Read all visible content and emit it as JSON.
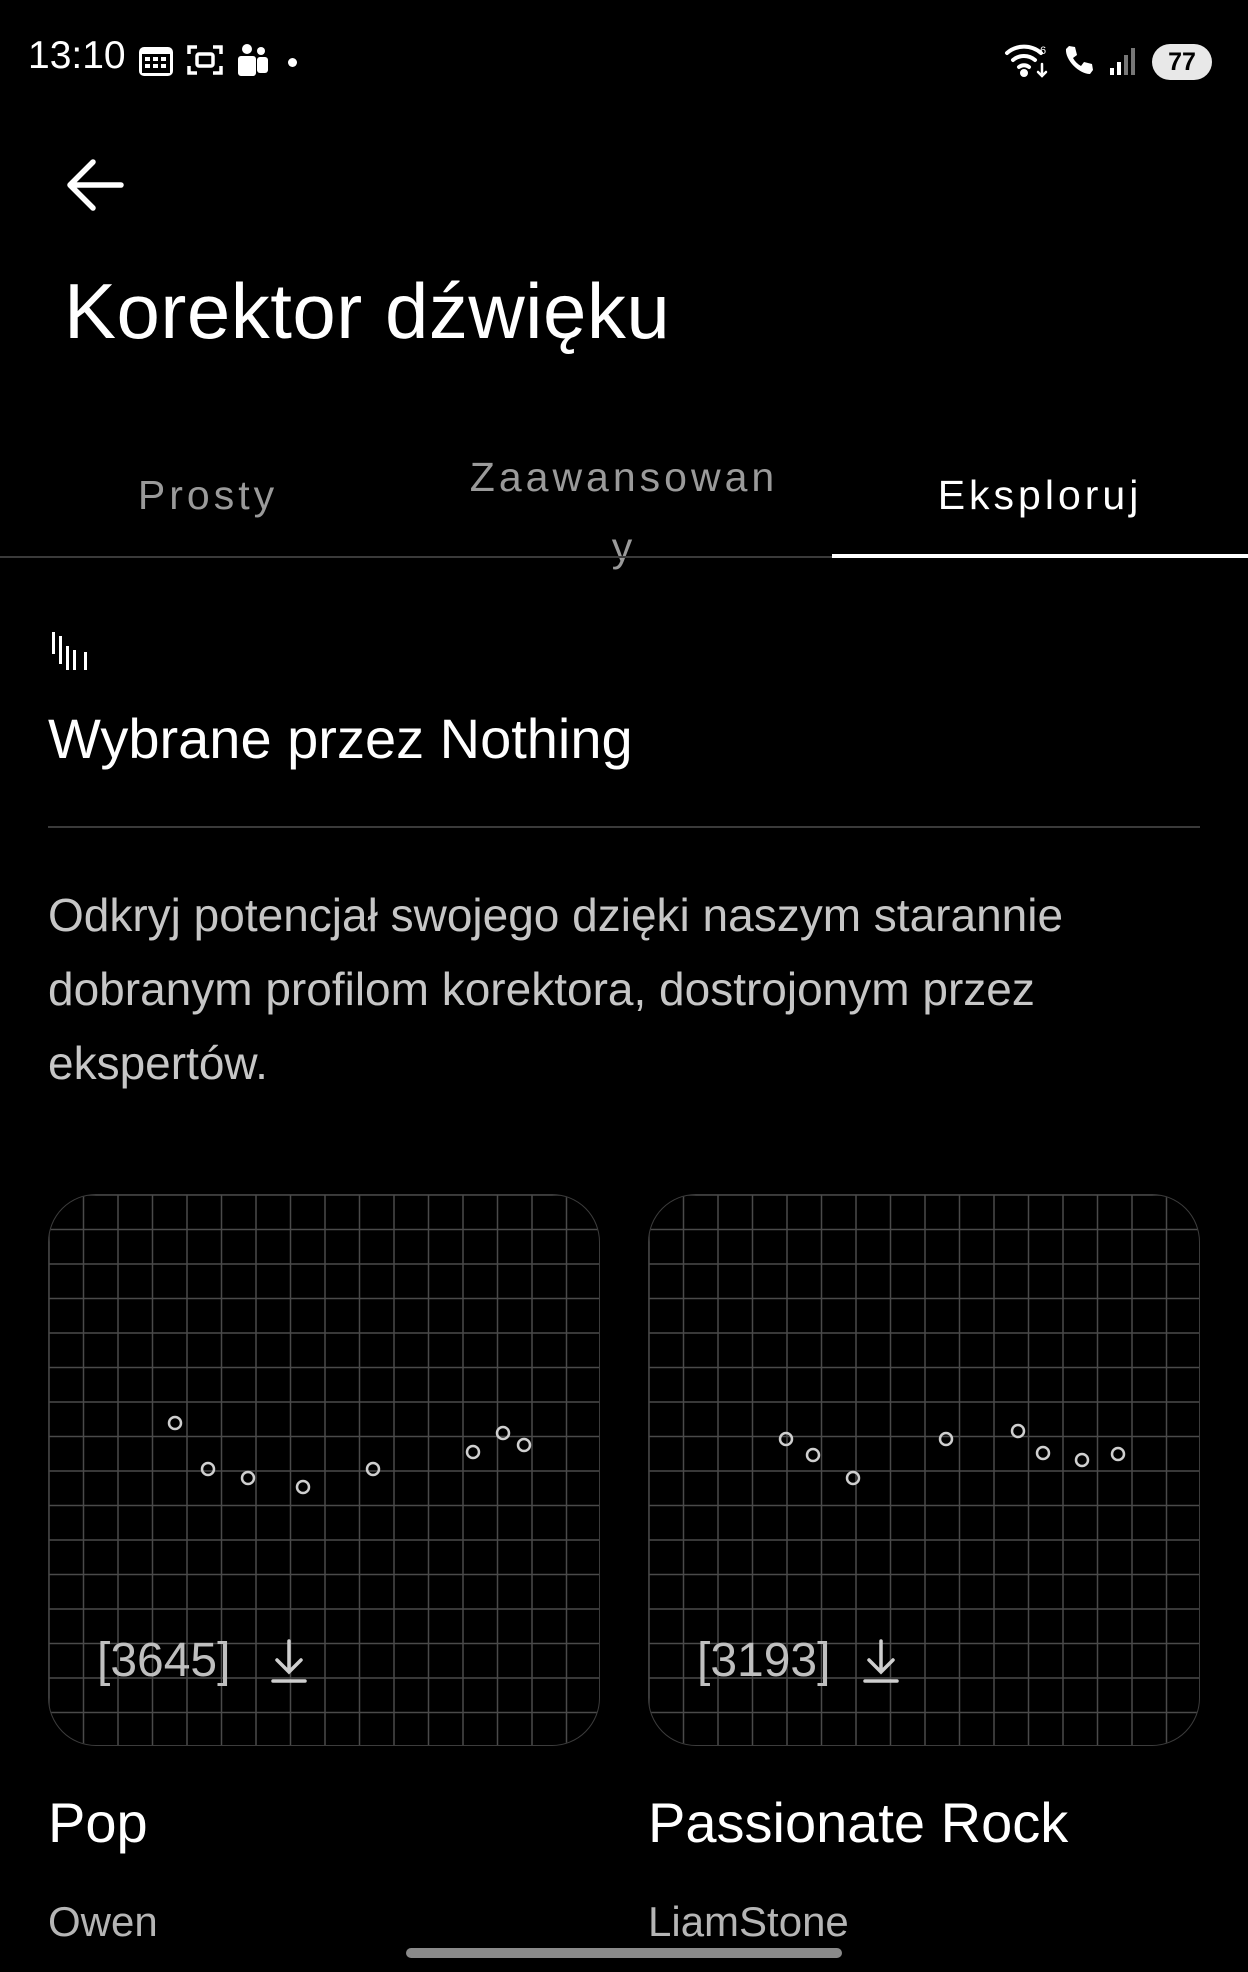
{
  "status_bar": {
    "time": "13:10",
    "left_icons": [
      "calendar-icon",
      "screenshot-icon",
      "teams-icon",
      "notification-dot"
    ],
    "right_icons": [
      "wifi-icon",
      "wifi-calling-icon",
      "signal-icon"
    ],
    "battery": "77"
  },
  "header": {
    "back_icon": "arrow-left-icon",
    "title": "Korektor dźwięku"
  },
  "tabs": [
    {
      "label": "Prosty",
      "selected": false
    },
    {
      "label": "Zaawansowany",
      "selected": false
    },
    {
      "label": "Eksploruj",
      "selected": true
    }
  ],
  "section": {
    "logo_icon": "nothing-logo-icon",
    "title": "Wybrane przez Nothing",
    "description": "Odkryj potencjał swojego  dzięki naszym starannie dobranym profilom korektora, dostrojonym przez ekspertów."
  },
  "profiles": [
    {
      "name": "Pop",
      "author": "Owen",
      "downloads": "[3645]",
      "download_icon": "download-icon"
    },
    {
      "name": "Passionate Rock",
      "author": "LiamStone",
      "downloads": "[3193]",
      "download_icon": "download-icon"
    }
  ],
  "colors": {
    "background": "#000000",
    "text_primary": "#ffffff",
    "text_secondary": "#c6c6c6",
    "divider": "#3a3a3a",
    "grid": "#4a4a4a"
  }
}
